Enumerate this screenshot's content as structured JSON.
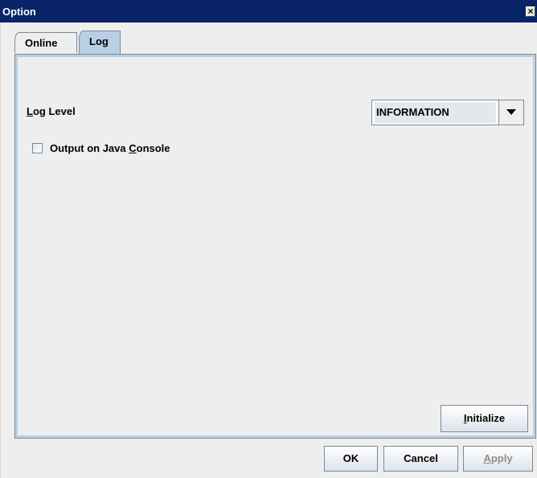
{
  "window": {
    "title": "Option",
    "close_symbol": "×"
  },
  "tabs": [
    {
      "label": "Online",
      "active": false
    },
    {
      "label": "Log",
      "active": true
    }
  ],
  "log_panel": {
    "log_level": {
      "label_first": "L",
      "label_rest": "og Level",
      "selected_value": "INFORMATION"
    },
    "output_console": {
      "label_prefix": "Output on Java ",
      "label_mnemonic": "C",
      "label_suffix": "onsole",
      "checked": false
    },
    "initialize_button": {
      "mnemonic": "I",
      "rest": "nitialize"
    }
  },
  "footer": {
    "ok_label": "OK",
    "cancel_label": "Cancel",
    "apply": {
      "mnemonic": "A",
      "rest": "pply",
      "enabled": false
    }
  },
  "colors": {
    "title_bar": "#0a246a",
    "tab_active": "#b8cfe5",
    "border": "#7a8a99"
  }
}
